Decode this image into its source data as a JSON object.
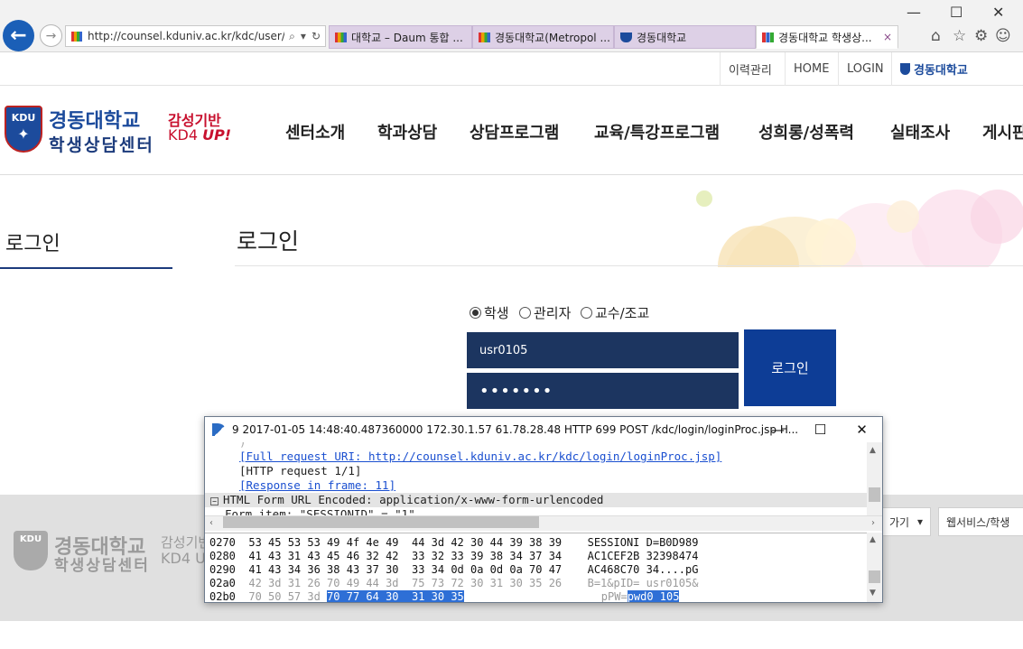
{
  "browser": {
    "url": "http://counsel.kduniv.ac.kr/kdc/user/m",
    "tabs": [
      {
        "label": "대학교 – Daum 통합 ...",
        "icon": "rainbow"
      },
      {
        "label": "경동대학교(Metropol ...",
        "icon": "rainbow"
      },
      {
        "label": "경동대학교",
        "icon": "shield"
      },
      {
        "label": "경동대학교 학생상...",
        "icon": "bars",
        "close": "×"
      }
    ],
    "window_controls": [
      "—",
      "☐",
      "✕"
    ],
    "toolbar_icons": [
      "home-icon",
      "star-icon",
      "gear-icon",
      "smiley-icon"
    ]
  },
  "site": {
    "top_nav": [
      "이력관리",
      "HOME",
      "LOGIN"
    ],
    "top_brand": "경동대학교",
    "logo_badge": "KDU",
    "logo_name": "경동대학교",
    "logo_sub": "학생상담센터",
    "logo_tag1": "감성기반",
    "logo_tag2_a": "KD4 ",
    "logo_tag2_b": "UP!",
    "menu": [
      "센터소개",
      "학과상담",
      "상담프로그램",
      "교육/특강프로그램",
      "성희롱/성폭력",
      "실태조사",
      "게시판"
    ],
    "side_title": "로그인",
    "page_title": "로그인",
    "radios": [
      {
        "label": "학생",
        "checked": true
      },
      {
        "label": "관리자",
        "checked": false
      },
      {
        "label": "교수/조교",
        "checked": false
      }
    ],
    "user_id": "usr0105",
    "password_mask": "•••••••",
    "login_button": "로그인",
    "footer": {
      "badge": "KDU",
      "name": "경동대학교",
      "sub": "학생상담센터",
      "tag1": "감성기반",
      "tag2": "KD4 U",
      "select1": "가기",
      "select2": "웹서비스/학생"
    }
  },
  "wireshark": {
    "title": "9 2017-01-05 14:48:40.487360000 172.30.1.57 61.78.28.48 HTTP 699 POST /kdc/login/loginProc.jsp H...",
    "detail": [
      {
        "text": "[Full request URI: http://counsel.kduniv.ac.kr/kdc/login/loginProc.jsp]",
        "link": true
      },
      {
        "text": "[HTTP request 1/1]",
        "link": false
      },
      {
        "text": "[Response in frame: 11]",
        "link": true
      },
      {
        "text": "HTML Form URL Encoded: application/x-www-form-urlencoded",
        "link": false
      },
      {
        "text": "Form item: \"SESSIONID\" = \"1\"",
        "link": false
      }
    ],
    "hex": [
      {
        "off": "0270",
        "bytes": "53 45 53 53 49 4f 4e 49  44 3d 42 30 44 39 38 39",
        "ascii": "SESSIONI D=B0D989"
      },
      {
        "off": "0280",
        "bytes": "41 43 31 43 45 46 32 42  33 32 33 39 38 34 37 34",
        "ascii": "AC1CEF2B 32398474"
      },
      {
        "off": "0290",
        "bytes": "41 43 34 36 38 43 37 30  33 34 0d 0a 0d 0a 70 47",
        "ascii": "AC468C70 34....pG"
      },
      {
        "off": "02a0",
        "bytes": "42 3d 31 26 70 49 44 3d  75 73 72 30 31 30 35 26",
        "ascii": "B=1&pID= usr0105&"
      },
      {
        "off": "02b0",
        "bytes_pre": "70 50 57 3d ",
        "bytes_sel": "70 77 64 30  31 30 35",
        "ascii_pre": "pPW=",
        "ascii_sel": "pwd0 105"
      }
    ]
  }
}
